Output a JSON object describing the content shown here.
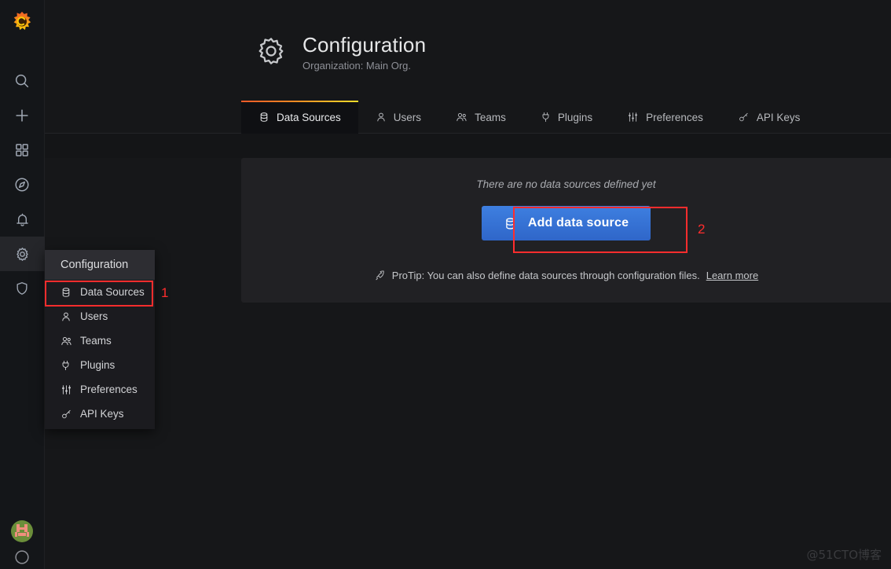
{
  "sidebar": {
    "logo": "grafana-logo",
    "items": [
      {
        "icon": "search-icon",
        "name": "search"
      },
      {
        "icon": "plus-icon",
        "name": "create"
      },
      {
        "icon": "dashboards-icon",
        "name": "dashboards"
      },
      {
        "icon": "compass-icon",
        "name": "explore"
      },
      {
        "icon": "bell-icon",
        "name": "alerting"
      },
      {
        "icon": "gear-icon",
        "name": "configuration"
      },
      {
        "icon": "shield-icon",
        "name": "server-admin"
      }
    ],
    "avatar": "user-avatar",
    "help": "help-icon"
  },
  "header": {
    "icon": "gear-icon",
    "title": "Configuration",
    "subtitle": "Organization: Main Org."
  },
  "tabs": [
    {
      "label": "Data Sources",
      "icon": "database-icon",
      "active": true
    },
    {
      "label": "Users",
      "icon": "user-icon",
      "active": false
    },
    {
      "label": "Teams",
      "icon": "users-icon",
      "active": false
    },
    {
      "label": "Plugins",
      "icon": "plug-icon",
      "active": false
    },
    {
      "label": "Preferences",
      "icon": "sliders-icon",
      "active": false
    },
    {
      "label": "API Keys",
      "icon": "key-icon",
      "active": false
    }
  ],
  "main": {
    "empty_message": "There are no data sources defined yet",
    "add_button_label": "Add data source",
    "add_button_icon": "database-icon",
    "protip_icon": "rocket-icon",
    "protip_text": "ProTip: You can also define data sources through configuration files.",
    "protip_link": "Learn more"
  },
  "flyout": {
    "header": "Configuration",
    "items": [
      {
        "label": "Data Sources",
        "icon": "database-icon"
      },
      {
        "label": "Users",
        "icon": "user-icon"
      },
      {
        "label": "Teams",
        "icon": "users-icon"
      },
      {
        "label": "Plugins",
        "icon": "plug-icon"
      },
      {
        "label": "Preferences",
        "icon": "sliders-icon"
      },
      {
        "label": "API Keys",
        "icon": "key-icon"
      }
    ]
  },
  "annotations": [
    {
      "number": "1",
      "target": "flyout-data-sources"
    },
    {
      "number": "2",
      "target": "add-data-source-button"
    }
  ],
  "watermark": "@51CTO博客",
  "colors": {
    "accent_orange": "#f05a28",
    "accent_yellow": "#fade2a",
    "button_blue": "#3274d9",
    "annotation_red": "#ff2d2d",
    "page_bg": "#161719",
    "panel_bg": "#212124"
  }
}
